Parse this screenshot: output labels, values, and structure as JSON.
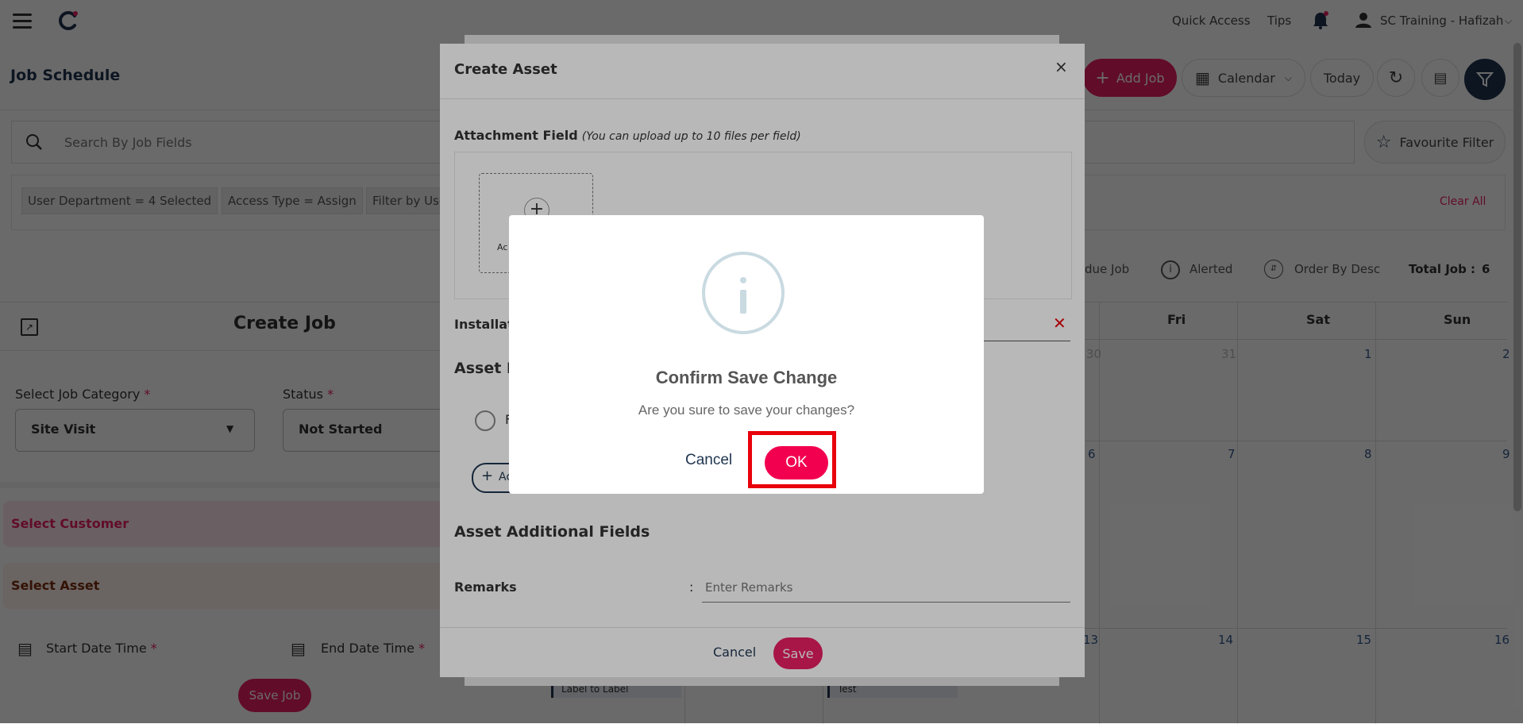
{
  "topbar": {
    "quick_access": "Quick Access",
    "tips": "Tips",
    "user": "SC Training - Hafizah"
  },
  "header": {
    "title": "Job Schedule",
    "add_job": "Add Job",
    "view": "Calendar",
    "today": "Today"
  },
  "search": {
    "placeholder": "Search By Job Fields",
    "favourite": "Favourite Filter"
  },
  "filters": {
    "chips": [
      "User Department = 4 Selected",
      "Access Type = Assign",
      "Filter by Use"
    ],
    "clear_all": "Clear All"
  },
  "stats": {
    "overdue": "due Job",
    "alerted": "Alerted",
    "order": "Order By Desc",
    "total_label": "Total Job :",
    "total_value": "6"
  },
  "calendar": {
    "days": [
      "Fri",
      "Sat",
      "Sun"
    ],
    "row1": [
      "30",
      "31",
      "1",
      "2"
    ],
    "row2": [
      "6",
      "7",
      "8",
      "9"
    ],
    "row3": [
      "13",
      "14",
      "15",
      "16"
    ],
    "events": [
      "Label to Label",
      "Test"
    ]
  },
  "create_job": {
    "title": "Create Job",
    "category_label": "Select Job Category",
    "category_value": "Site Visit",
    "status_label": "Status",
    "status_value": "Not Started",
    "select_customer": "Select Customer",
    "select_asset": "Select Asset",
    "start_date": "Start Date Time",
    "end_date": "End Date Time",
    "save": "Save Job",
    "required": "*"
  },
  "create_asset": {
    "title": "Create Asset",
    "attachment_label": "Attachment Field",
    "attachment_hint": "(You can upload up to 10 files per field)",
    "upload_text": "Ac",
    "installation_label": "Installat",
    "asset_section": "Asset F",
    "radio_label": "F",
    "add_label": "Ac",
    "additional_fields": "Asset Additional Fields",
    "remarks_label": "Remarks",
    "remarks_colon": ":",
    "remarks_placeholder": "Enter Remarks",
    "cancel": "Cancel",
    "save": "Save"
  },
  "confirm": {
    "title": "Confirm Save Change",
    "message": "Are you sure to save your changes?",
    "cancel": "Cancel",
    "ok": "OK"
  },
  "colors": {
    "accent": "#e91e63",
    "highlight": "#e8000b",
    "navy": "#1f3550"
  }
}
